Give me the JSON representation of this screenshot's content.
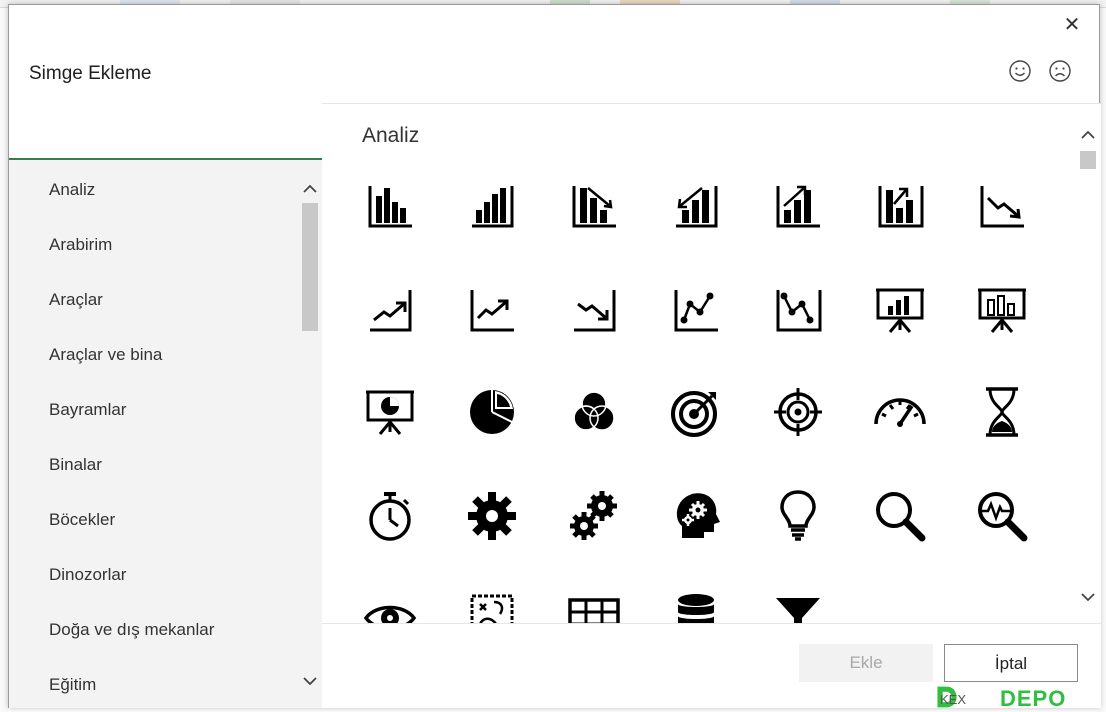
{
  "window": {
    "title": "Simge Ekleme",
    "close_glyph": "✕"
  },
  "sidebar": {
    "categories": [
      "Analiz",
      "Arabirim",
      "Araçlar",
      "Araçlar ve bina",
      "Bayramlar",
      "Binalar",
      "Böcekler",
      "Dinozorlar",
      "Doğa ve dış mekanlar",
      "Eğitim"
    ]
  },
  "content": {
    "section_title": "Analiz",
    "icons": [
      "bar-chart-icon",
      "bar-chart-rising-icon",
      "bar-chart-down-arrow-icon",
      "bar-chart-up-arrow-left-icon",
      "bar-chart-up-arrow-icon",
      "bar-chart-up-arrow-gap-icon",
      "line-chart-down-icon",
      "line-chart-up-arrow-icon",
      "line-chart-up-icon",
      "line-chart-down-zigzag-icon",
      "line-chart-points-up-icon",
      "line-chart-points-down-icon",
      "presentation-bar-chart-icon",
      "presentation-board-chart-icon",
      "presentation-pie-chart-icon",
      "pie-chart-icon",
      "venn-diagram-icon",
      "target-arrow-icon",
      "crosshair-target-icon",
      "speedometer-gauge-icon",
      "hourglass-icon",
      "stopwatch-icon",
      "gear-icon",
      "gears-icon",
      "head-gears-icon",
      "lightbulb-icon",
      "magnifier-icon",
      "magnifier-pulse-icon",
      "eye-icon",
      "strategy-board-icon",
      "table-grid-icon",
      "database-icon",
      "funnel-icon"
    ]
  },
  "footer": {
    "insert_label": "Ekle",
    "cancel_label": "İptal"
  },
  "watermark": {
    "text": "DEPO",
    "small": "KEX"
  },
  "colors": {
    "accent_green": "#3a7a4e",
    "sidebar_bg": "#f3f3f3",
    "watermark_green": "#2fbf3f"
  }
}
